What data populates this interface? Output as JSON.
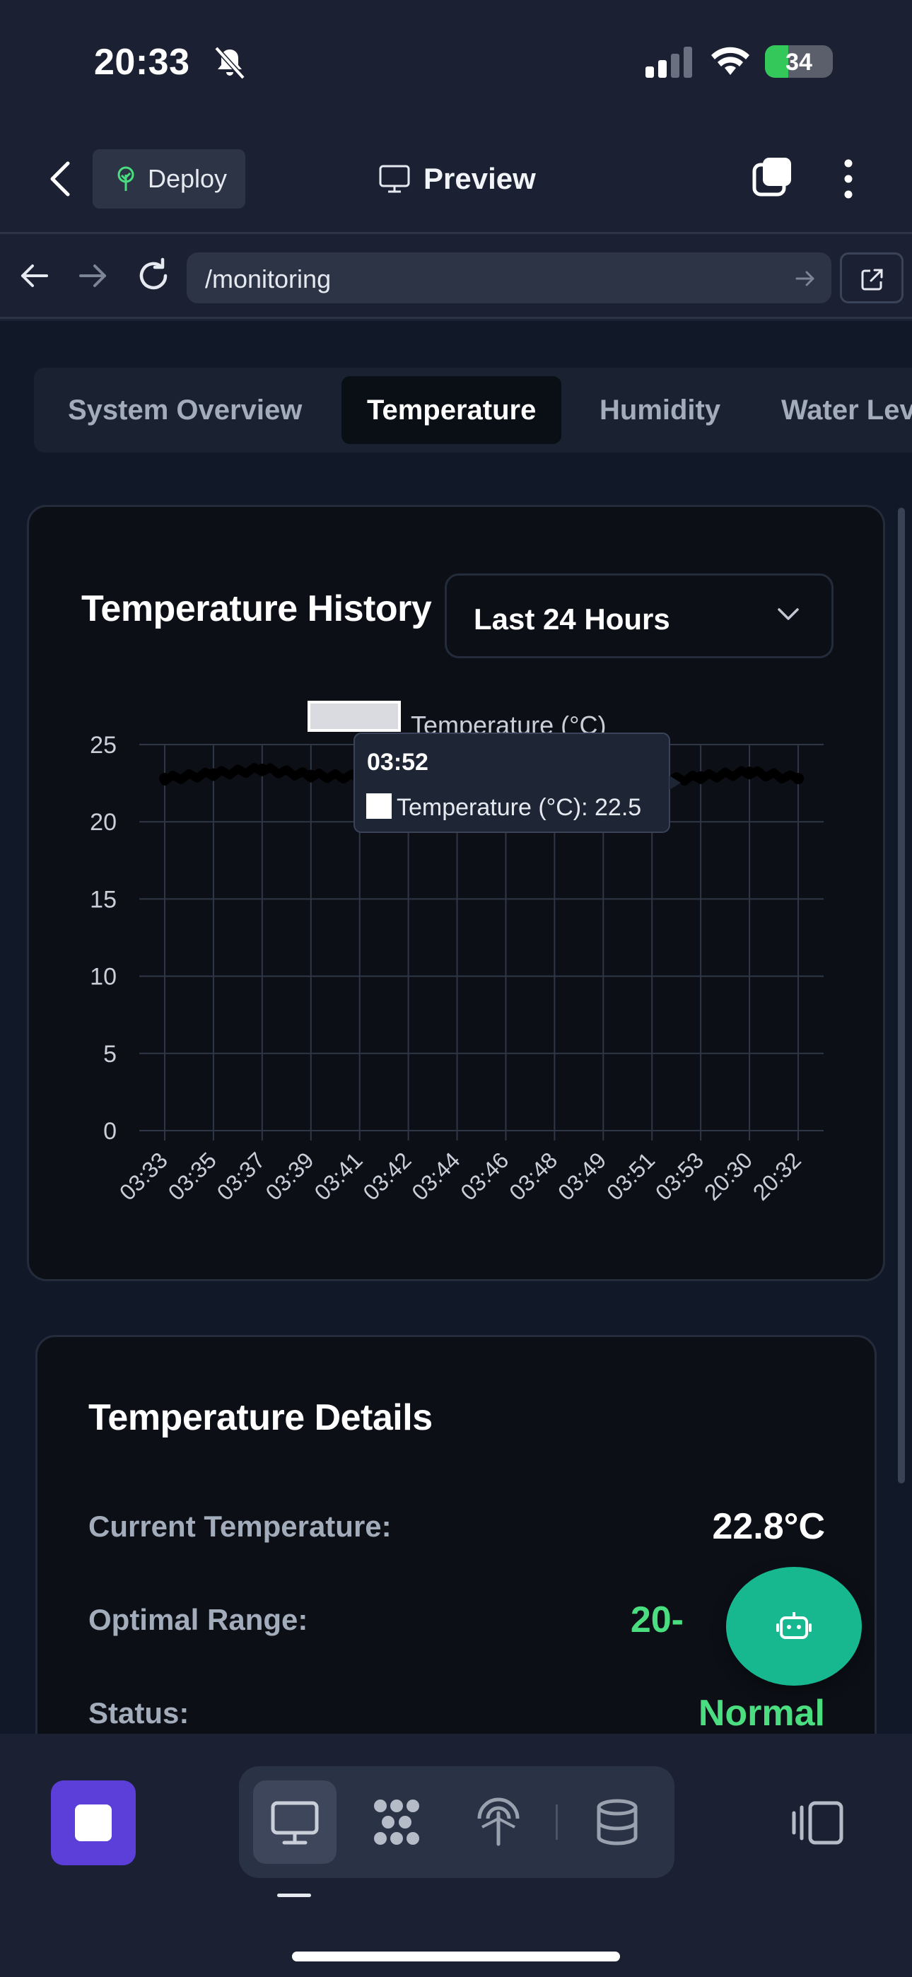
{
  "status_bar": {
    "time": "20:33",
    "battery": "34",
    "battery_level": 0.34
  },
  "header": {
    "deploy_label": "Deploy",
    "preview_label": "Preview"
  },
  "browser": {
    "url": "/monitoring"
  },
  "tabs": [
    {
      "label": "System Overview",
      "active": false
    },
    {
      "label": "Temperature",
      "active": true
    },
    {
      "label": "Humidity",
      "active": false
    },
    {
      "label": "Water Lev",
      "active": false
    }
  ],
  "history_card": {
    "title": "Temperature History",
    "range_select": "Last 24 Hours"
  },
  "chart_data": {
    "type": "line",
    "legend": [
      "Temperature (°C)"
    ],
    "xlabel": "",
    "ylabel": "",
    "ylim": [
      0,
      25
    ],
    "yticks": [
      0,
      5,
      10,
      15,
      20,
      25
    ],
    "categories": [
      "03:33",
      "03:35",
      "03:37",
      "03:39",
      "03:41",
      "03:42",
      "03:44",
      "03:46",
      "03:48",
      "03:49",
      "03:51",
      "03:53",
      "20:30",
      "20:32"
    ],
    "series": [
      {
        "name": "Temperature (°C)",
        "color": "#000000",
        "values": [
          22.8,
          23.1,
          23.4,
          23.0,
          22.9,
          22.7,
          22.9,
          23.1,
          22.8,
          22.5,
          22.6,
          22.9,
          23.2,
          22.8
        ]
      }
    ],
    "tooltip": {
      "title": "03:52",
      "label": "Temperature (°C): 22.5"
    },
    "grid": true,
    "legend_position": "top"
  },
  "details_card": {
    "title": "Temperature Details",
    "rows": [
      {
        "label": "Current Temperature:",
        "value": "22.8°C"
      },
      {
        "label": "Optimal Range:",
        "value": "20-"
      },
      {
        "label": "Status:",
        "value": "Normal"
      }
    ]
  },
  "colors": {
    "accent": "#5b3fd8",
    "fab": "#17b890",
    "good": "#4ade80",
    "page_bg": "#111827"
  },
  "icons": [
    "bell-slash-icon",
    "signal-icon",
    "wifi-icon",
    "battery-icon",
    "chevron-left-icon",
    "plant-icon",
    "monitor-icon",
    "tabs-icon",
    "more-vertical-icon",
    "arrow-left-icon",
    "arrow-right-icon",
    "reload-icon",
    "external-link-icon",
    "chevron-down-icon",
    "robot-icon",
    "stop-icon",
    "desktop-icon",
    "nodes-icon",
    "antenna-icon",
    "database-icon",
    "panel-icon"
  ]
}
